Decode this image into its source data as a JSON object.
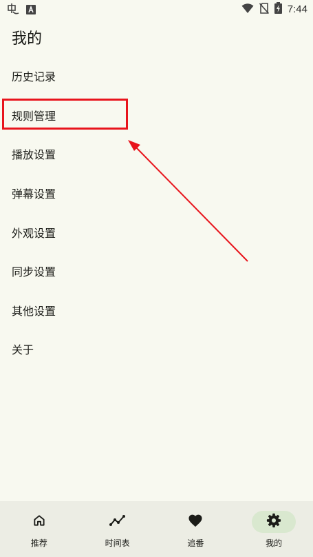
{
  "status_bar": {
    "time": "7:44",
    "left_icons": [
      "app-notification-icon",
      "a-box-icon"
    ],
    "right_icons": [
      "wifi-icon",
      "no-sim-icon",
      "battery-charging-icon"
    ]
  },
  "page": {
    "title": "我的"
  },
  "menu": {
    "items": [
      {
        "label": "历史记录"
      },
      {
        "label": "规则管理"
      },
      {
        "label": "播放设置"
      },
      {
        "label": "弹幕设置"
      },
      {
        "label": "外观设置"
      },
      {
        "label": "同步设置"
      },
      {
        "label": "其他设置"
      },
      {
        "label": "关于"
      }
    ]
  },
  "annotation": {
    "highlight_target": "规则管理",
    "color": "#e8141c"
  },
  "bottom_nav": {
    "active_index": 3,
    "items": [
      {
        "label": "推荐",
        "icon": "home-icon"
      },
      {
        "label": "时间表",
        "icon": "trend-line-icon"
      },
      {
        "label": "追番",
        "icon": "heart-icon"
      },
      {
        "label": "我的",
        "icon": "gear-icon"
      }
    ]
  },
  "colors": {
    "background": "#f8f9f0",
    "nav_background": "#ecede4",
    "active_pill": "#d9e8cf",
    "text": "#1b1c18"
  }
}
